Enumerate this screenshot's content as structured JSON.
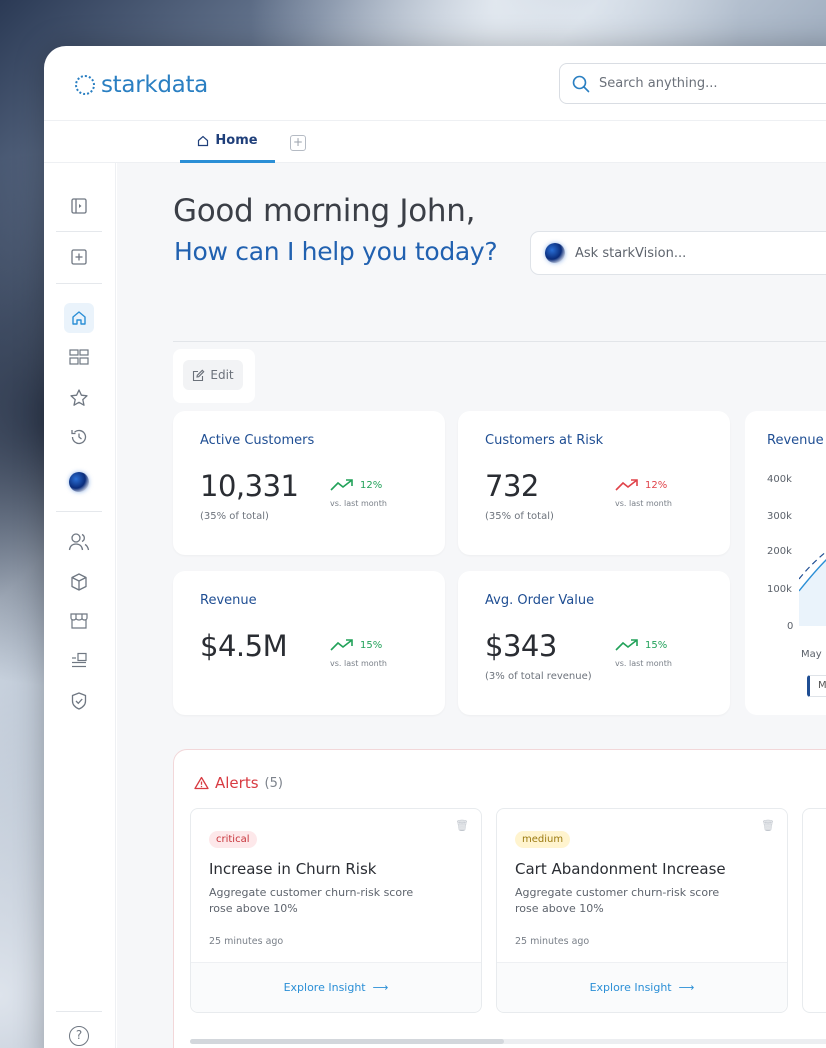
{
  "app": {
    "brand": "starkdata",
    "search_placeholder": "Search anything..."
  },
  "tabs": {
    "home_label": "Home"
  },
  "hero": {
    "greeting": "Good morning John,",
    "subtitle": "How can I help you today?",
    "ask_placeholder": "Ask starkVision..."
  },
  "toolbar": {
    "edit_label": "Edit"
  },
  "kpis": [
    {
      "title": "Active Customers",
      "value": "10,331",
      "sub": "(35% of total)",
      "pct": "12%",
      "direction": "up",
      "vs": "vs. last month"
    },
    {
      "title": "Customers at Risk",
      "value": "732",
      "sub": "(35% of total)",
      "pct": "12%",
      "direction": "down",
      "vs": "vs. last month"
    },
    {
      "title": "Revenue",
      "value": "$4.5M",
      "sub": "",
      "pct": "15%",
      "direction": "up",
      "vs": "vs. last month"
    },
    {
      "title": "Avg. Order Value",
      "value": "$343",
      "sub": "(3% of total revenue)",
      "pct": "15%",
      "direction": "up",
      "vs": "vs. last month"
    }
  ],
  "chart_data": {
    "type": "area",
    "title": "Revenue",
    "yticks": [
      "400k",
      "300k",
      "200k",
      "100k",
      "0"
    ],
    "x": [
      "May"
    ],
    "ylim": [
      0,
      400000
    ],
    "legend": "M"
  },
  "alerts": {
    "title": "Alerts",
    "count": "(5)",
    "items": [
      {
        "severity": "critical",
        "title": "Increase in Churn Risk",
        "desc": "Aggregate customer churn-risk score rose above 10%",
        "time": "25 minutes ago",
        "cta": "Explore Insight"
      },
      {
        "severity": "medium",
        "title": "Cart Abandonment Increase",
        "desc": "Aggregate customer churn-risk score rose above 10%",
        "time": "25 minutes ago",
        "cta": "Explore Insight"
      }
    ]
  },
  "colors": {
    "brand": "#2a7fc2",
    "accent": "#2b8fd6",
    "up": "#22a25a",
    "down": "#e0434a"
  },
  "icons": [
    "panel-toggle-icon",
    "new-tab-icon",
    "home-icon",
    "dashboard-icon",
    "star-icon",
    "history-icon",
    "stark-orb-icon",
    "users-icon",
    "box-icon",
    "store-icon",
    "list-icon",
    "shield-icon",
    "help-icon"
  ]
}
